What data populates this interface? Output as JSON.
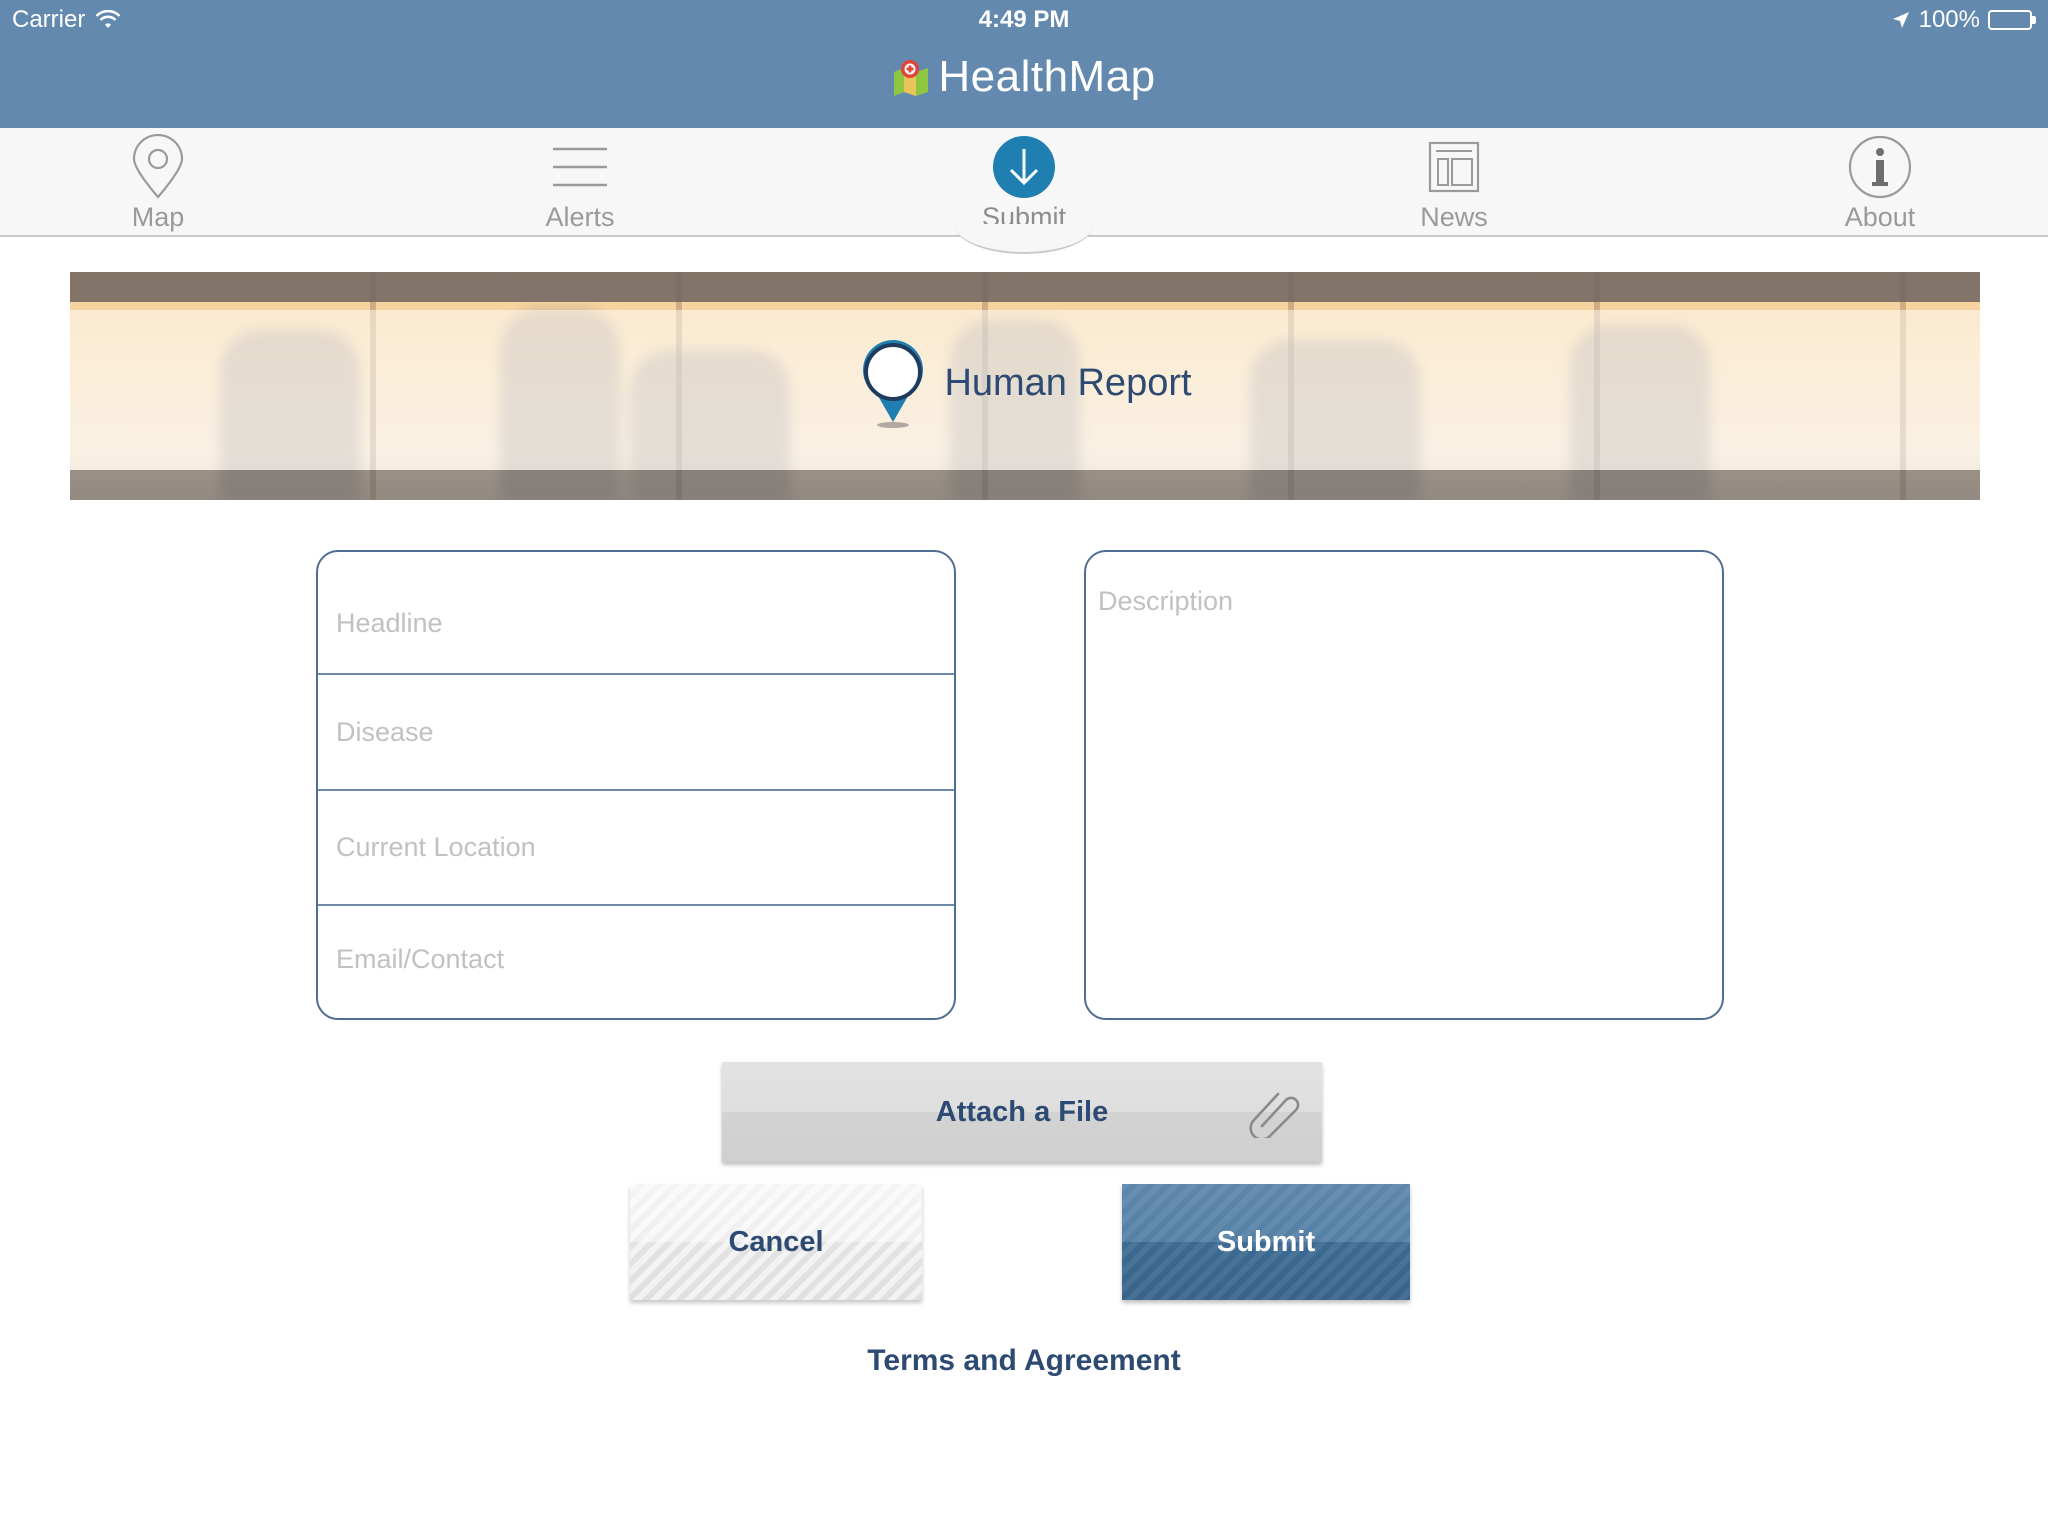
{
  "status_bar": {
    "carrier": "Carrier",
    "time": "4:49 PM",
    "battery": "100%",
    "icons": [
      "wifi-icon",
      "location-arrow-icon",
      "battery-icon"
    ]
  },
  "app": {
    "title": "HealthMap",
    "brand_color": "#6489ae",
    "logo_icon": "healthmap-logo-icon"
  },
  "tabs": [
    {
      "label": "Map",
      "icon": "map-pin-icon",
      "active": false
    },
    {
      "label": "Alerts",
      "icon": "list-icon",
      "active": false
    },
    {
      "label": "Submit",
      "icon": "download-arrow-icon",
      "active": true
    },
    {
      "label": "News",
      "icon": "newspaper-icon",
      "active": false
    },
    {
      "label": "About",
      "icon": "info-icon",
      "active": false
    }
  ],
  "banner": {
    "title": "Human Report",
    "icon": "location-pin-icon"
  },
  "form": {
    "headline_placeholder": "Headline",
    "disease_placeholder": "Disease",
    "location_placeholder": "Current Location",
    "contact_placeholder": "Email/Contact",
    "description_placeholder": "Description"
  },
  "actions": {
    "attach_label": "Attach a File",
    "cancel_label": "Cancel",
    "submit_label": "Submit",
    "terms_label": "Terms and Agreement",
    "submit_color": "#3d6a92",
    "accent_color": "#2d4a73"
  }
}
